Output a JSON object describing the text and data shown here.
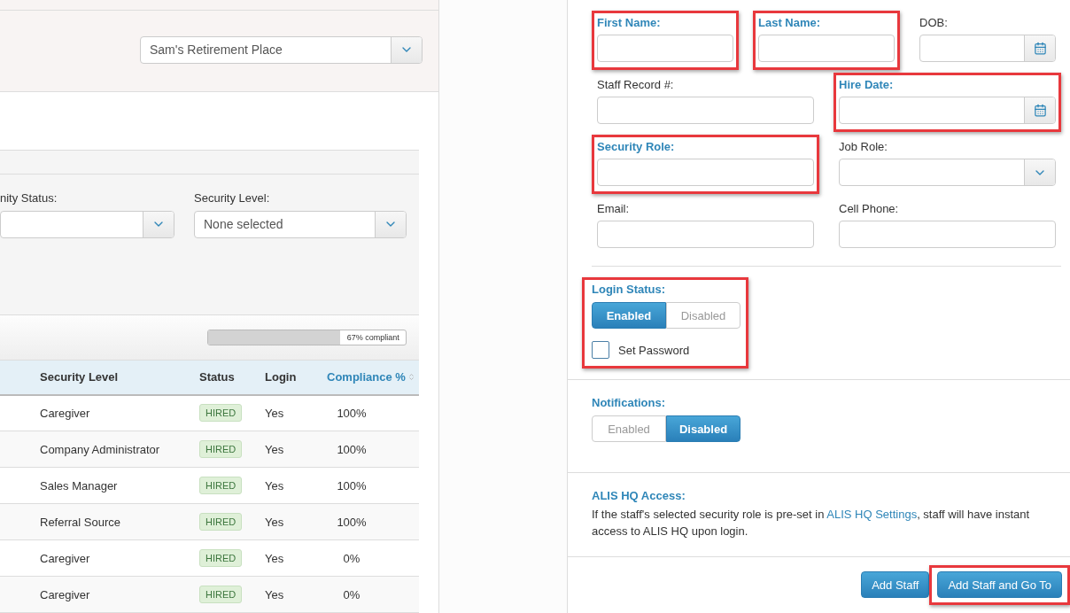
{
  "facility_select": {
    "value": "Sam's Retirement Place"
  },
  "filters": [
    {
      "label": "nity Status:"
    },
    {
      "label": "Security Level:",
      "value": "None selected"
    }
  ],
  "compliance": {
    "level": 0.67,
    "label": "67% compliant"
  },
  "table": {
    "columns": [
      {
        "label": "Security Level",
        "sortable": false
      },
      {
        "label": "Status",
        "sortable": false
      },
      {
        "label": "Login",
        "sortable": false
      },
      {
        "label": "Compliance %",
        "sortable": true
      }
    ],
    "rows": [
      {
        "security_level": "Caregiver",
        "status": "HIRED",
        "login": "Yes",
        "compliance": "100%"
      },
      {
        "security_level": "Company Administrator",
        "status": "HIRED",
        "login": "Yes",
        "compliance": "100%"
      },
      {
        "security_level": "Sales Manager",
        "status": "HIRED",
        "login": "Yes",
        "compliance": "100%"
      },
      {
        "security_level": "Referral Source",
        "status": "HIRED",
        "login": "Yes",
        "compliance": "100%"
      },
      {
        "security_level": "Caregiver",
        "status": "HIRED",
        "login": "Yes",
        "compliance": "0%"
      },
      {
        "security_level": "Caregiver",
        "status": "HIRED",
        "login": "Yes",
        "compliance": "0%"
      }
    ]
  },
  "form": {
    "rows": [
      [
        {
          "label": "First Name:",
          "kind": "text",
          "required": true,
          "highlighted": true
        },
        {
          "label": "Last Name:",
          "kind": "text",
          "required": true,
          "highlighted": true
        },
        {
          "label": "DOB:",
          "kind": "date",
          "required": false,
          "highlighted": false
        }
      ],
      [
        {
          "label": "Staff Record #:",
          "kind": "text",
          "required": false,
          "highlighted": false
        },
        {
          "label": "Hire Date:",
          "kind": "date",
          "required": true,
          "highlighted": true
        }
      ],
      [
        {
          "label": "Security Role:",
          "kind": "text",
          "required": true,
          "highlighted": true
        },
        {
          "label": "Job Role:",
          "kind": "select",
          "required": false,
          "highlighted": false
        }
      ],
      [
        {
          "label": "Email:",
          "kind": "text",
          "required": false,
          "highlighted": false
        },
        {
          "label": "Cell Phone:",
          "kind": "text",
          "required": false,
          "highlighted": false
        }
      ]
    ]
  },
  "login_status": {
    "label": "Login Status:",
    "highlighted": true,
    "options": [
      {
        "label": "Enabled",
        "selected": true
      },
      {
        "label": "Disabled",
        "selected": false
      }
    ],
    "set_password": {
      "label": "Set Password",
      "checked": false
    }
  },
  "notifications": {
    "label": "Notifications:",
    "options": [
      {
        "label": "Enabled",
        "selected": false
      },
      {
        "label": "Disabled",
        "selected": true
      }
    ]
  },
  "alis_hq": {
    "title": "ALIS HQ Access:",
    "text_before": "If the staff's selected security role is pre-set in ",
    "link": "ALIS HQ Settings",
    "text_after": ", staff will have instant access to ALIS HQ upon login."
  },
  "buttons": [
    {
      "label": "Add Staff",
      "highlighted": false
    },
    {
      "label": "Add Staff and Go To",
      "highlighted": true
    }
  ]
}
